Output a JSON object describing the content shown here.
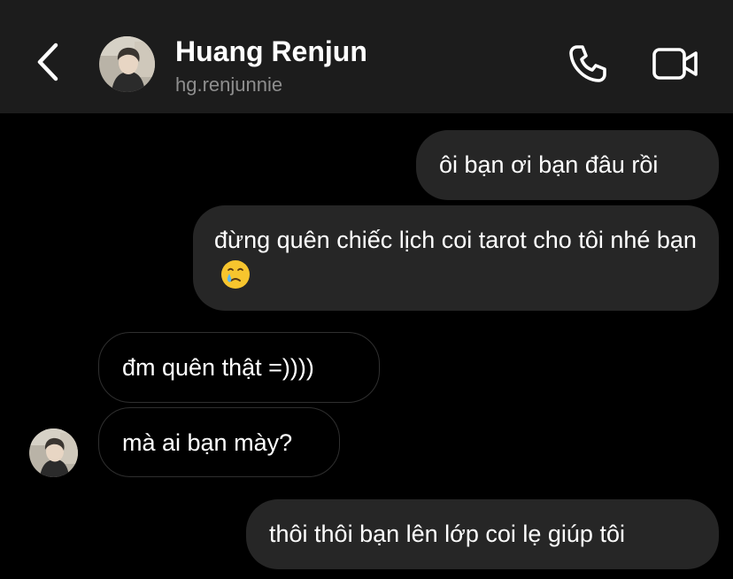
{
  "header": {
    "name": "Huang Renjun",
    "username": "hg.renjunnie",
    "back_icon": "chevron-left-icon",
    "call_icon": "phone-icon",
    "video_icon": "video-camera-icon"
  },
  "messages": [
    {
      "direction": "outgoing",
      "text": "ôi bạn ơi bạn đâu rồi"
    },
    {
      "direction": "outgoing",
      "text": "đừng quên chiếc lịch coi tarot cho tôi nhé bạn",
      "emoji": "face-holding-back-tears"
    },
    {
      "direction": "incoming",
      "text": "đm quên thật =))))"
    },
    {
      "direction": "incoming",
      "text": "mà ai bạn mày?"
    },
    {
      "direction": "outgoing",
      "text": "thôi thôi bạn lên lớp coi lẹ giúp tôi"
    }
  ],
  "colors": {
    "background": "#000000",
    "header_background": "#1c1c1c",
    "outgoing_bubble": "#262626",
    "incoming_bubble_border": "#2f2f2f",
    "username": "#8e8e8e"
  }
}
